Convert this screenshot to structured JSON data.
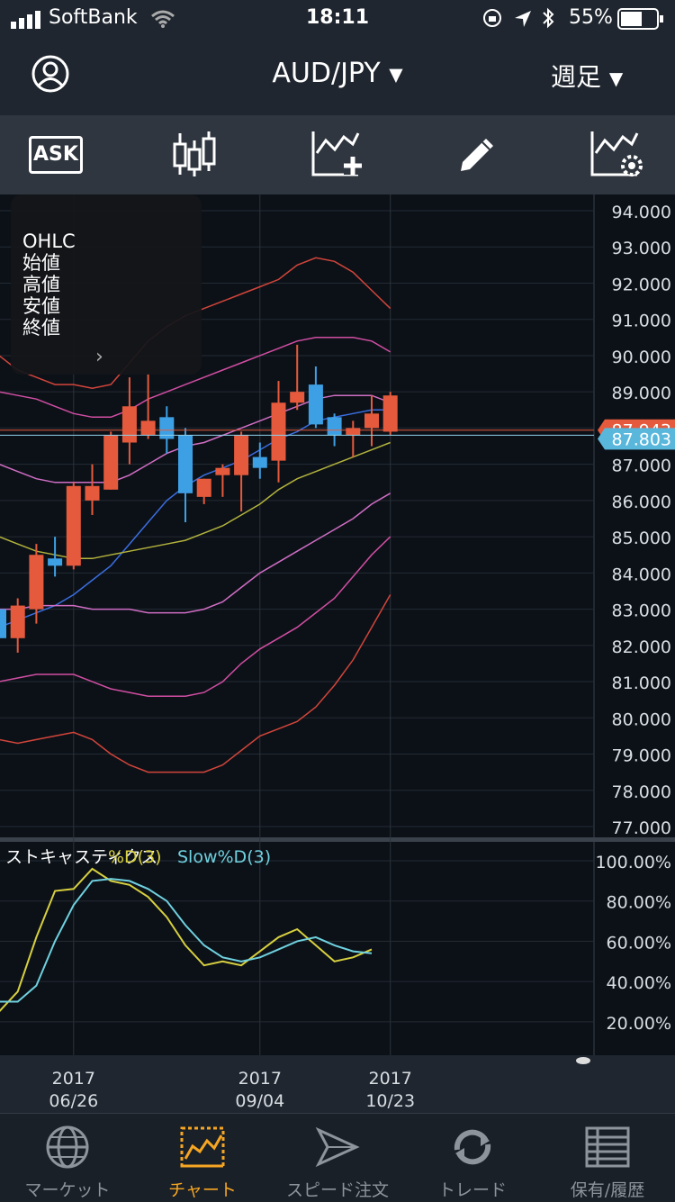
{
  "status_bar": {
    "carrier": "SoftBank",
    "time": "18:11",
    "battery": "55%"
  },
  "header": {
    "pair": "AUD/JPY",
    "period": "週足"
  },
  "toolbar": {
    "ask_label": "ASK"
  },
  "ohlc_panel": {
    "title": "OHLC",
    "open": "始値",
    "high": "高値",
    "low": "安値",
    "close": "終値"
  },
  "chart_data": [
    {
      "type": "candlestick",
      "title": "",
      "ylim": [
        77.0,
        94.0
      ],
      "y_ticks": [
        "94.000",
        "93.000",
        "92.000",
        "91.000",
        "90.000",
        "89.000",
        "88.000",
        "87.000",
        "86.000",
        "85.000",
        "84.000",
        "83.000",
        "82.000",
        "81.000",
        "80.000",
        "79.000",
        "78.000",
        "77.000"
      ],
      "current_price_labels": {
        "ask": "87.943",
        "bid": "87.803"
      },
      "x_tick_labels": [
        {
          "year": "2017",
          "date": "06/26"
        },
        {
          "year": "2017",
          "date": "09/04"
        },
        {
          "year": "2017",
          "date": "10/23"
        }
      ],
      "candles": [
        {
          "o": 83.0,
          "h": 84.0,
          "l": 82.0,
          "c": 82.2
        },
        {
          "o": 82.2,
          "h": 83.3,
          "l": 81.8,
          "c": 83.1
        },
        {
          "o": 83.0,
          "h": 84.8,
          "l": 82.6,
          "c": 84.5
        },
        {
          "o": 84.4,
          "h": 85.0,
          "l": 83.9,
          "c": 84.2
        },
        {
          "o": 84.2,
          "h": 86.5,
          "l": 84.1,
          "c": 86.4
        },
        {
          "o": 86.0,
          "h": 87.0,
          "l": 85.6,
          "c": 86.4
        },
        {
          "o": 86.3,
          "h": 87.9,
          "l": 86.3,
          "c": 87.8
        },
        {
          "o": 87.6,
          "h": 89.4,
          "l": 87.0,
          "c": 88.6
        },
        {
          "o": 87.8,
          "h": 89.5,
          "l": 87.7,
          "c": 88.2
        },
        {
          "o": 88.3,
          "h": 88.6,
          "l": 87.3,
          "c": 87.7
        },
        {
          "o": 87.8,
          "h": 88.0,
          "l": 85.4,
          "c": 86.2
        },
        {
          "o": 86.1,
          "h": 86.6,
          "l": 85.9,
          "c": 86.6
        },
        {
          "o": 86.7,
          "h": 87.0,
          "l": 86.1,
          "c": 86.9
        },
        {
          "o": 86.7,
          "h": 87.9,
          "l": 85.7,
          "c": 87.8
        },
        {
          "o": 87.2,
          "h": 87.6,
          "l": 86.6,
          "c": 86.9
        },
        {
          "o": 87.1,
          "h": 89.3,
          "l": 86.5,
          "c": 88.7
        },
        {
          "o": 88.7,
          "h": 90.3,
          "l": 88.5,
          "c": 89.0
        },
        {
          "o": 89.2,
          "h": 89.7,
          "l": 88.0,
          "c": 88.1
        },
        {
          "o": 88.3,
          "h": 88.4,
          "l": 87.5,
          "c": 87.8
        },
        {
          "o": 87.8,
          "h": 88.2,
          "l": 87.2,
          "c": 88.0
        },
        {
          "o": 88.0,
          "h": 88.9,
          "l": 87.5,
          "c": 88.4
        },
        {
          "o": 87.9,
          "h": 89.0,
          "l": 87.8,
          "c": 88.9
        }
      ],
      "up_color": "#e55a3c",
      "down_color": "#3ea0e4",
      "series": [
        {
          "color": "#d2453a",
          "values": [
            90.0,
            89.6,
            89.4,
            89.2,
            89.2,
            89.1,
            89.2,
            89.8,
            90.4,
            90.8,
            91.1,
            91.3,
            91.5,
            91.7,
            91.9,
            92.1,
            92.5,
            92.7,
            92.6,
            92.3,
            91.8,
            91.3
          ]
        },
        {
          "color": "#d14ea2",
          "values": [
            89.0,
            88.9,
            88.8,
            88.6,
            88.4,
            88.3,
            88.3,
            88.5,
            88.8,
            89.0,
            89.2,
            89.4,
            89.6,
            89.8,
            90.0,
            90.2,
            90.4,
            90.5,
            90.5,
            90.5,
            90.4,
            90.1
          ]
        },
        {
          "color": "#d06ec4",
          "values": [
            87.0,
            86.8,
            86.6,
            86.5,
            86.5,
            86.5,
            86.5,
            86.7,
            87.0,
            87.3,
            87.5,
            87.6,
            87.8,
            88.0,
            88.2,
            88.4,
            88.6,
            88.8,
            88.9,
            88.9,
            88.9,
            88.7
          ]
        },
        {
          "color": "#3a6ee0",
          "values": [
            82.5,
            82.7,
            82.9,
            83.1,
            83.4,
            83.8,
            84.2,
            84.8,
            85.4,
            86.0,
            86.4,
            86.7,
            86.9,
            87.1,
            87.4,
            87.7,
            87.9,
            88.2,
            88.3,
            88.4,
            88.5,
            88.5
          ]
        },
        {
          "color": "#b3b33c",
          "values": [
            85.0,
            84.8,
            84.6,
            84.5,
            84.4,
            84.4,
            84.5,
            84.6,
            84.7,
            84.8,
            84.9,
            85.1,
            85.3,
            85.6,
            85.9,
            86.3,
            86.6,
            86.8,
            87.0,
            87.2,
            87.4,
            87.6
          ]
        },
        {
          "color": "#d06ec4",
          "values": [
            83.0,
            83.0,
            83.1,
            83.1,
            83.1,
            83.0,
            83.0,
            83.0,
            82.9,
            82.9,
            82.9,
            83.0,
            83.2,
            83.6,
            84.0,
            84.3,
            84.6,
            84.9,
            85.2,
            85.5,
            85.9,
            86.2
          ]
        },
        {
          "color": "#d14ea2",
          "values": [
            81.0,
            81.1,
            81.2,
            81.2,
            81.2,
            81.0,
            80.8,
            80.7,
            80.6,
            80.6,
            80.6,
            80.7,
            81.0,
            81.5,
            81.9,
            82.2,
            82.5,
            82.9,
            83.3,
            83.9,
            84.5,
            85.0
          ]
        },
        {
          "color": "#d2453a",
          "values": [
            79.4,
            79.3,
            79.4,
            79.5,
            79.6,
            79.4,
            79.0,
            78.7,
            78.5,
            78.5,
            78.5,
            78.5,
            78.7,
            79.1,
            79.5,
            79.7,
            79.9,
            80.3,
            80.9,
            81.6,
            82.5,
            83.4
          ]
        }
      ]
    },
    {
      "type": "line",
      "title": "ストキャスティクス",
      "ylim": [
        15,
        100
      ],
      "y_ticks": [
        "100.00%",
        "80.00%",
        "60.00%",
        "40.00%",
        "20.00%"
      ],
      "series": [
        {
          "name": "%D(3)",
          "color": "#d7d03f",
          "values": [
            25,
            35,
            62,
            85,
            86,
            96,
            90,
            88,
            82,
            72,
            58,
            48,
            50,
            48,
            55,
            62,
            66,
            58,
            50,
            52,
            56
          ]
        },
        {
          "name": "Slow%D(3)",
          "color": "#6fd1df",
          "values": [
            30,
            30,
            38,
            60,
            78,
            90,
            91,
            90,
            86,
            80,
            68,
            58,
            52,
            50,
            52,
            56,
            60,
            62,
            58,
            55,
            54
          ]
        }
      ]
    }
  ],
  "tabs": [
    {
      "label": "マーケット"
    },
    {
      "label": "チャート"
    },
    {
      "label": "スピード注文"
    },
    {
      "label": "トレード"
    },
    {
      "label": "保有/履歴"
    }
  ]
}
